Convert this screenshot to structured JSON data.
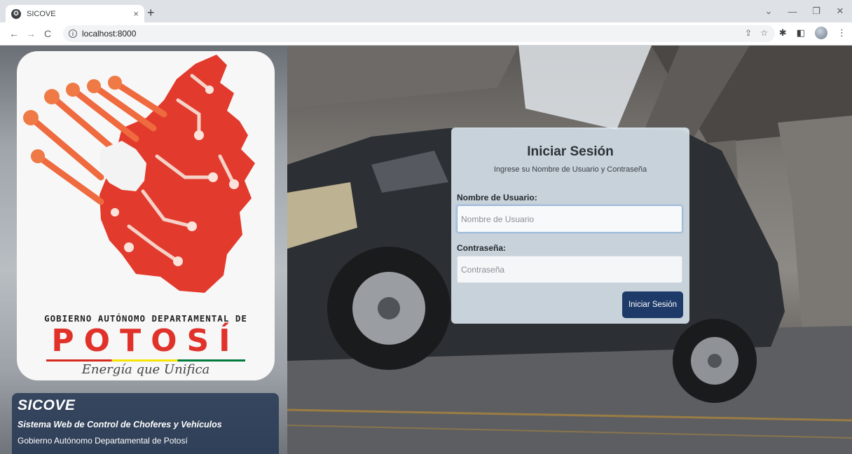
{
  "browser": {
    "tab_title": "SICOVE",
    "tab_close": "×",
    "new_tab": "+",
    "url": "localhost:8000",
    "controls": {
      "minimize": "—",
      "maximize": "❐",
      "close": "✕",
      "collapse": "⌄"
    }
  },
  "sidebar": {
    "government_line": "GOBIERNO AUTÓNOMO DEPARTAMENTAL DE",
    "region_name": "POTOSÍ",
    "slogan": "Energía que Unifica",
    "app_name": "SICOVE",
    "app_description": "Sistema Web de Control de Choferes y Vehículos",
    "organization": "Gobierno Autónomo Departamental de Potosí"
  },
  "login": {
    "title": "Iniciar Sesión",
    "subtitle": "Ingrese su Nombre de Usuario y Contraseña",
    "username_label": "Nombre de Usuario:",
    "username_placeholder": "Nombre de Usuario",
    "password_label": "Contraseña:",
    "password_placeholder": "Contraseña",
    "submit_label": "Iniciar Sesión"
  },
  "colors": {
    "primary_button": "#1e3a68",
    "info_panel": "#223450",
    "logo_red": "#e0322a"
  }
}
